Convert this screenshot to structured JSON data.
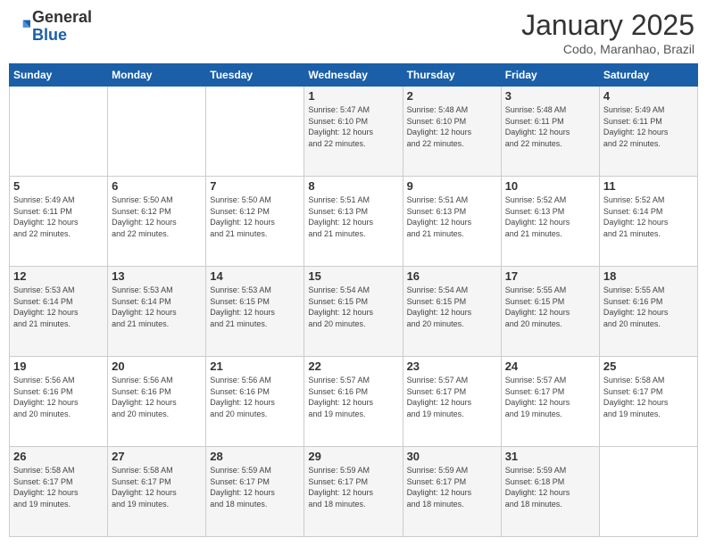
{
  "logo": {
    "general": "General",
    "blue": "Blue"
  },
  "header": {
    "month": "January 2025",
    "location": "Codo, Maranhao, Brazil"
  },
  "weekdays": [
    "Sunday",
    "Monday",
    "Tuesday",
    "Wednesday",
    "Thursday",
    "Friday",
    "Saturday"
  ],
  "weeks": [
    [
      {
        "day": "",
        "info": ""
      },
      {
        "day": "",
        "info": ""
      },
      {
        "day": "",
        "info": ""
      },
      {
        "day": "1",
        "info": "Sunrise: 5:47 AM\nSunset: 6:10 PM\nDaylight: 12 hours\nand 22 minutes."
      },
      {
        "day": "2",
        "info": "Sunrise: 5:48 AM\nSunset: 6:10 PM\nDaylight: 12 hours\nand 22 minutes."
      },
      {
        "day": "3",
        "info": "Sunrise: 5:48 AM\nSunset: 6:11 PM\nDaylight: 12 hours\nand 22 minutes."
      },
      {
        "day": "4",
        "info": "Sunrise: 5:49 AM\nSunset: 6:11 PM\nDaylight: 12 hours\nand 22 minutes."
      }
    ],
    [
      {
        "day": "5",
        "info": "Sunrise: 5:49 AM\nSunset: 6:11 PM\nDaylight: 12 hours\nand 22 minutes."
      },
      {
        "day": "6",
        "info": "Sunrise: 5:50 AM\nSunset: 6:12 PM\nDaylight: 12 hours\nand 22 minutes."
      },
      {
        "day": "7",
        "info": "Sunrise: 5:50 AM\nSunset: 6:12 PM\nDaylight: 12 hours\nand 21 minutes."
      },
      {
        "day": "8",
        "info": "Sunrise: 5:51 AM\nSunset: 6:13 PM\nDaylight: 12 hours\nand 21 minutes."
      },
      {
        "day": "9",
        "info": "Sunrise: 5:51 AM\nSunset: 6:13 PM\nDaylight: 12 hours\nand 21 minutes."
      },
      {
        "day": "10",
        "info": "Sunrise: 5:52 AM\nSunset: 6:13 PM\nDaylight: 12 hours\nand 21 minutes."
      },
      {
        "day": "11",
        "info": "Sunrise: 5:52 AM\nSunset: 6:14 PM\nDaylight: 12 hours\nand 21 minutes."
      }
    ],
    [
      {
        "day": "12",
        "info": "Sunrise: 5:53 AM\nSunset: 6:14 PM\nDaylight: 12 hours\nand 21 minutes."
      },
      {
        "day": "13",
        "info": "Sunrise: 5:53 AM\nSunset: 6:14 PM\nDaylight: 12 hours\nand 21 minutes."
      },
      {
        "day": "14",
        "info": "Sunrise: 5:53 AM\nSunset: 6:15 PM\nDaylight: 12 hours\nand 21 minutes."
      },
      {
        "day": "15",
        "info": "Sunrise: 5:54 AM\nSunset: 6:15 PM\nDaylight: 12 hours\nand 20 minutes."
      },
      {
        "day": "16",
        "info": "Sunrise: 5:54 AM\nSunset: 6:15 PM\nDaylight: 12 hours\nand 20 minutes."
      },
      {
        "day": "17",
        "info": "Sunrise: 5:55 AM\nSunset: 6:15 PM\nDaylight: 12 hours\nand 20 minutes."
      },
      {
        "day": "18",
        "info": "Sunrise: 5:55 AM\nSunset: 6:16 PM\nDaylight: 12 hours\nand 20 minutes."
      }
    ],
    [
      {
        "day": "19",
        "info": "Sunrise: 5:56 AM\nSunset: 6:16 PM\nDaylight: 12 hours\nand 20 minutes."
      },
      {
        "day": "20",
        "info": "Sunrise: 5:56 AM\nSunset: 6:16 PM\nDaylight: 12 hours\nand 20 minutes."
      },
      {
        "day": "21",
        "info": "Sunrise: 5:56 AM\nSunset: 6:16 PM\nDaylight: 12 hours\nand 20 minutes."
      },
      {
        "day": "22",
        "info": "Sunrise: 5:57 AM\nSunset: 6:16 PM\nDaylight: 12 hours\nand 19 minutes."
      },
      {
        "day": "23",
        "info": "Sunrise: 5:57 AM\nSunset: 6:17 PM\nDaylight: 12 hours\nand 19 minutes."
      },
      {
        "day": "24",
        "info": "Sunrise: 5:57 AM\nSunset: 6:17 PM\nDaylight: 12 hours\nand 19 minutes."
      },
      {
        "day": "25",
        "info": "Sunrise: 5:58 AM\nSunset: 6:17 PM\nDaylight: 12 hours\nand 19 minutes."
      }
    ],
    [
      {
        "day": "26",
        "info": "Sunrise: 5:58 AM\nSunset: 6:17 PM\nDaylight: 12 hours\nand 19 minutes."
      },
      {
        "day": "27",
        "info": "Sunrise: 5:58 AM\nSunset: 6:17 PM\nDaylight: 12 hours\nand 19 minutes."
      },
      {
        "day": "28",
        "info": "Sunrise: 5:59 AM\nSunset: 6:17 PM\nDaylight: 12 hours\nand 18 minutes."
      },
      {
        "day": "29",
        "info": "Sunrise: 5:59 AM\nSunset: 6:17 PM\nDaylight: 12 hours\nand 18 minutes."
      },
      {
        "day": "30",
        "info": "Sunrise: 5:59 AM\nSunset: 6:17 PM\nDaylight: 12 hours\nand 18 minutes."
      },
      {
        "day": "31",
        "info": "Sunrise: 5:59 AM\nSunset: 6:18 PM\nDaylight: 12 hours\nand 18 minutes."
      },
      {
        "day": "",
        "info": ""
      }
    ]
  ],
  "shaded_rows": [
    0,
    2,
    4
  ]
}
